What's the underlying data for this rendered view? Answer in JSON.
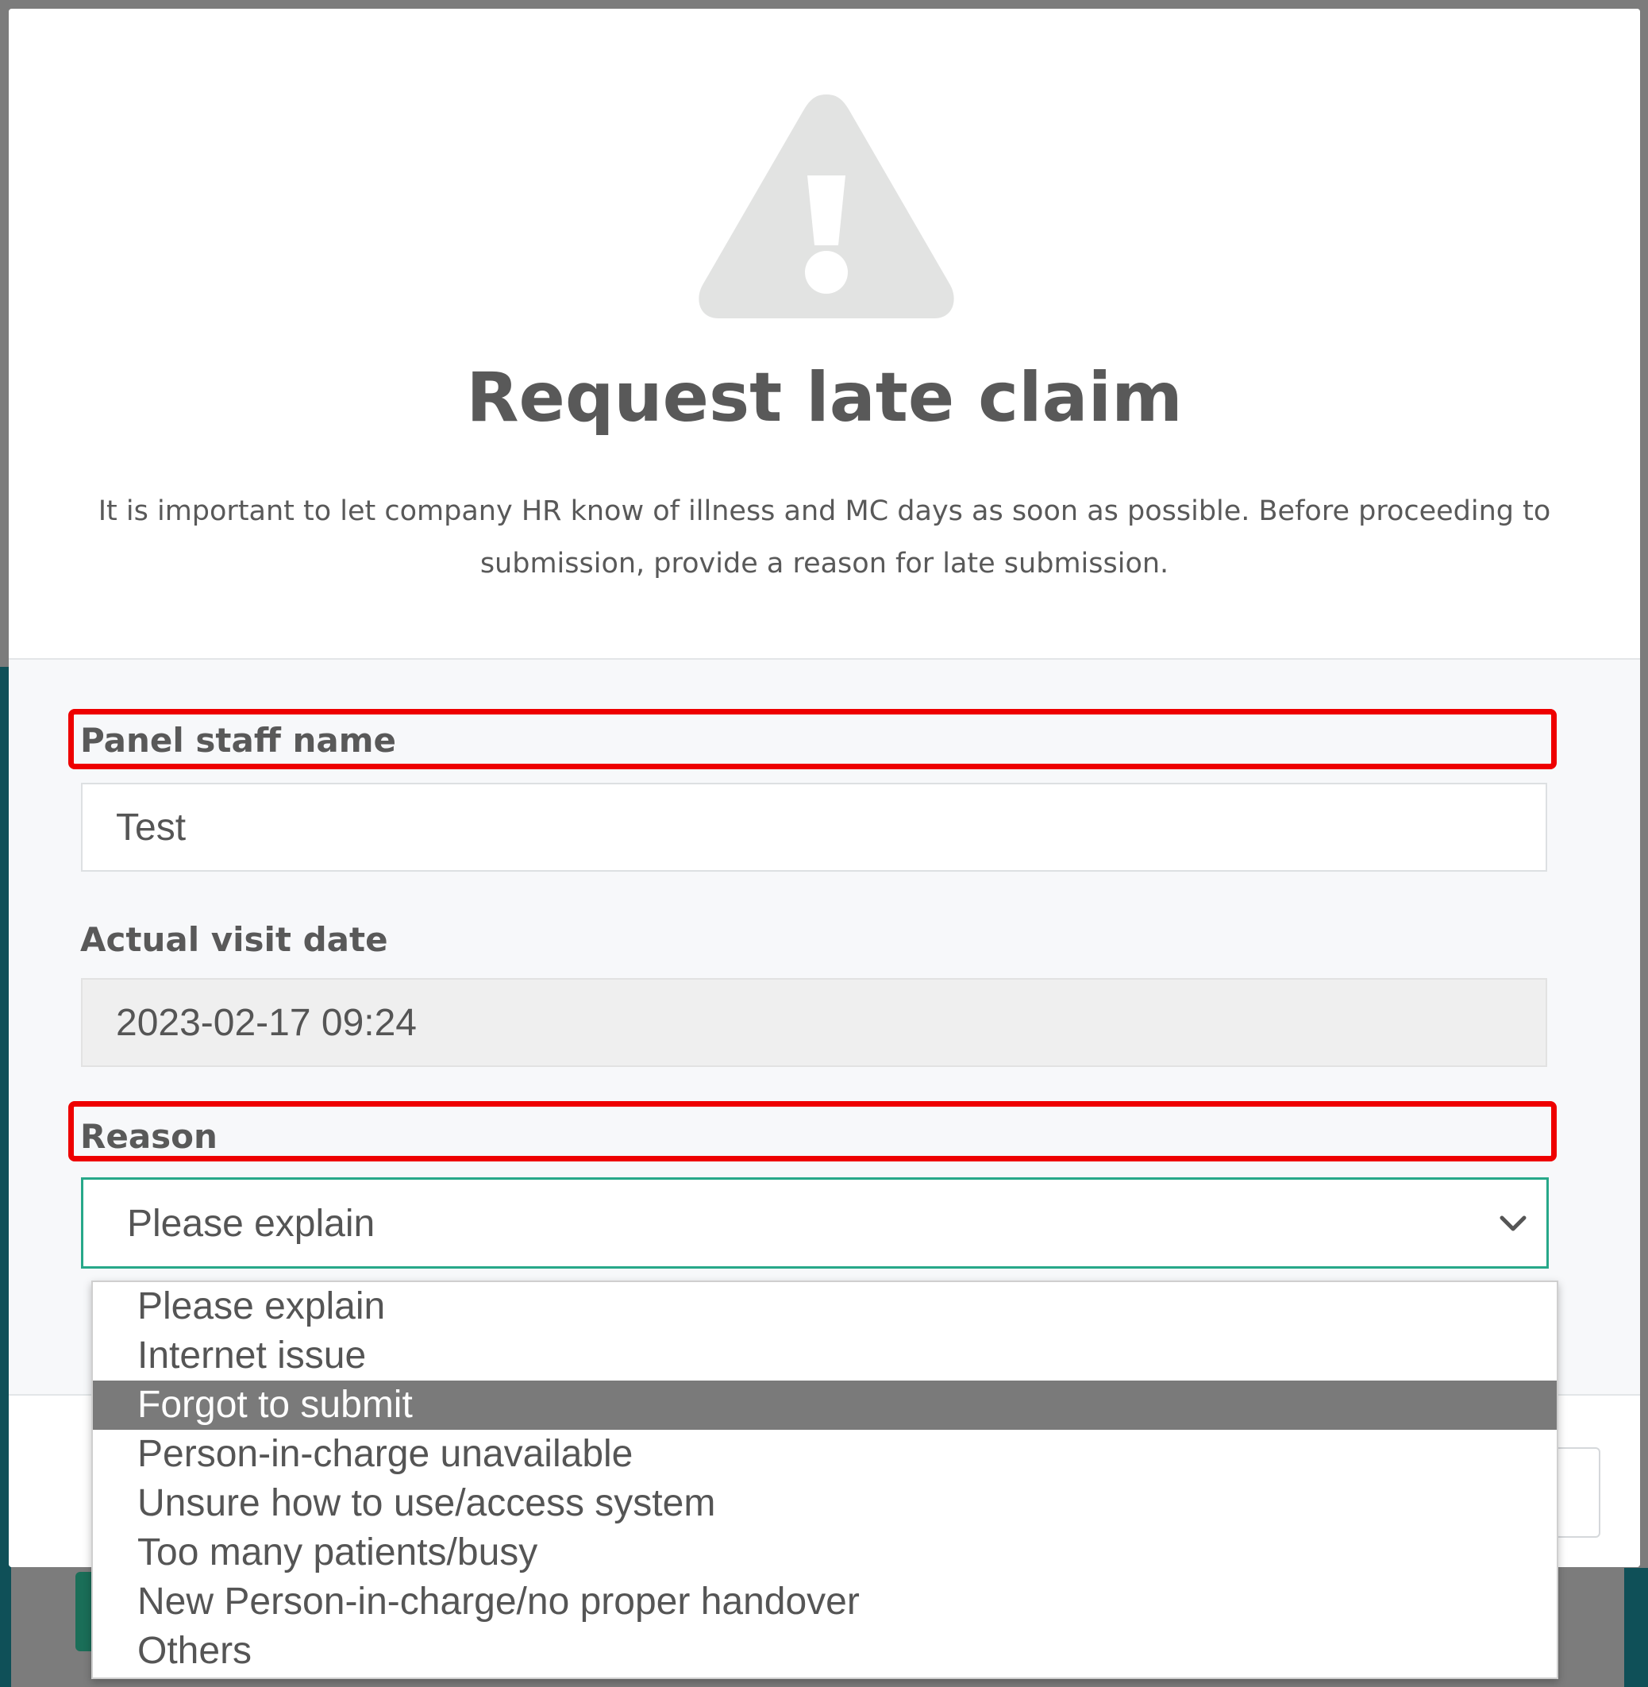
{
  "dialog": {
    "title": "Request late claim",
    "description": "It is important to let company HR know of illness and MC days as soon as possible. Before proceeding to submission, provide a reason for late submission."
  },
  "form": {
    "staff_name": {
      "label": "Panel staff name",
      "value": "Test"
    },
    "visit_date": {
      "label": "Actual visit date",
      "value": "2023-02-17 09:24"
    },
    "reason": {
      "label": "Reason",
      "selected": "Please explain",
      "highlighted_option": "Forgot to submit",
      "options": [
        "Please explain",
        "Internet issue",
        "Forgot to submit",
        "Person-in-charge unavailable",
        "Unsure how to use/access system",
        "Too many patients/busy",
        "New Person-in-charge/no proper handover",
        "Others"
      ]
    }
  },
  "icons": {
    "warning": "warning-triangle-icon",
    "chevron": "chevron-down-icon"
  },
  "colors": {
    "highlight_border": "#ee0000",
    "focus_border": "#27a889",
    "selected_option_bg": "#7a7a7a",
    "icon_gray": "#e2e3e2"
  }
}
